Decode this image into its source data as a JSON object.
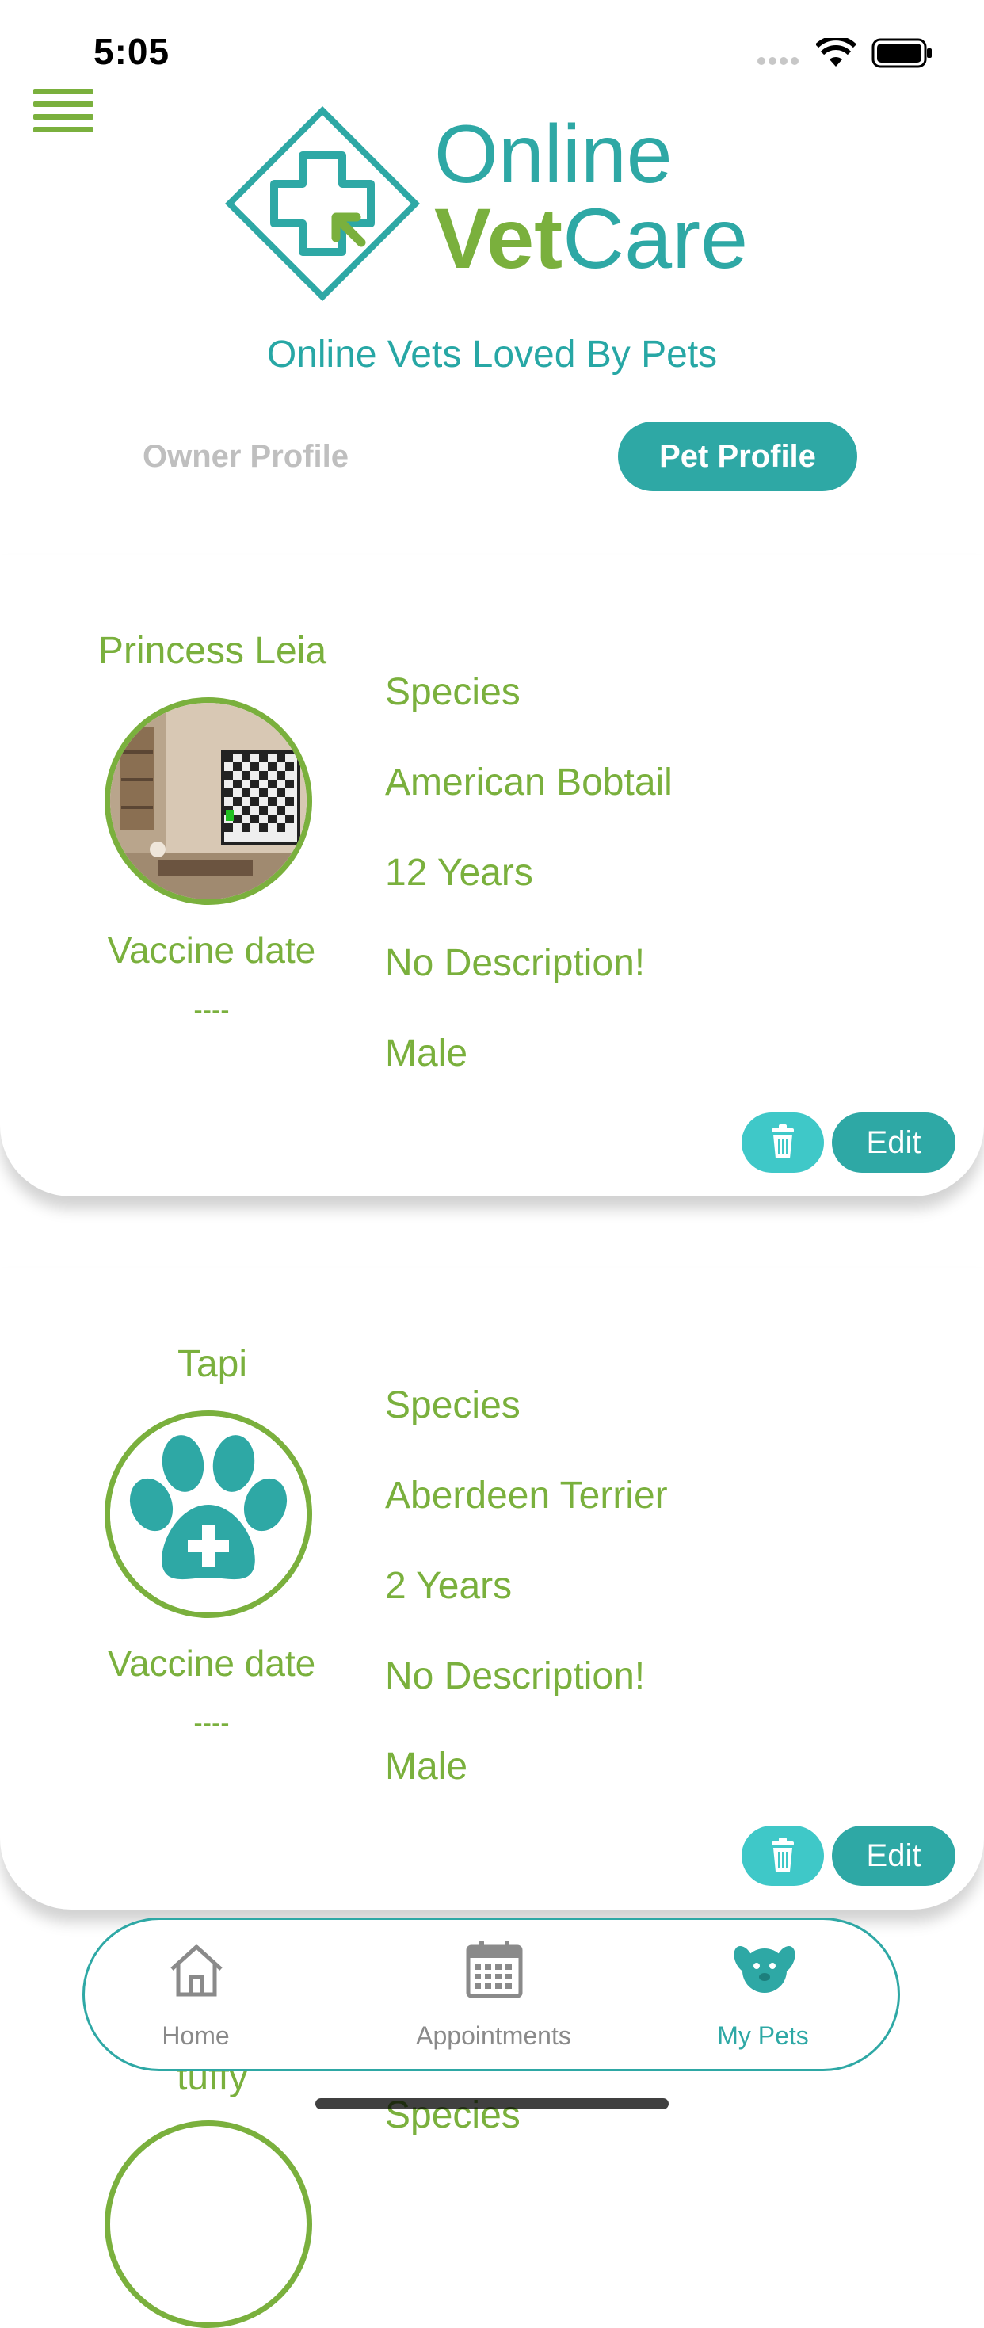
{
  "status_bar": {
    "time": "5:05"
  },
  "app": {
    "logo_word1": "Online",
    "logo_word2a": "Vet",
    "logo_word2b": "Care",
    "tagline": "Online Vets Loved By Pets",
    "colors": {
      "teal": "#2ea8a5",
      "green": "#7ab03d",
      "light_teal": "#3fc8c8"
    }
  },
  "tabs": {
    "owner": "Owner Profile",
    "pet": "Pet Profile",
    "active": "pet"
  },
  "pets": [
    {
      "name": "Princess Leia",
      "vaccine_label": "Vaccine date",
      "vaccine_value": "----",
      "species": "Species",
      "breed": "American Bobtail",
      "age": "12 Years",
      "description": "No Description!",
      "gender": "Male",
      "edit_label": "Edit",
      "delete_icon": "trash-icon"
    },
    {
      "name": "Tapi",
      "vaccine_label": "Vaccine date",
      "vaccine_value": "----",
      "species": "Species",
      "breed": "Aberdeen Terrier",
      "age": "2 Years",
      "description": "No Description!",
      "gender": "Male",
      "edit_label": "Edit",
      "delete_icon": "trash-icon"
    },
    {
      "name": "tuffy",
      "species": "Species"
    }
  ],
  "bottom_nav": {
    "items": [
      {
        "label": "Home",
        "icon": "home-icon"
      },
      {
        "label": "Appointments",
        "icon": "calendar-icon"
      },
      {
        "label": "My Pets",
        "icon": "pet-icon"
      }
    ],
    "active": "My Pets"
  }
}
